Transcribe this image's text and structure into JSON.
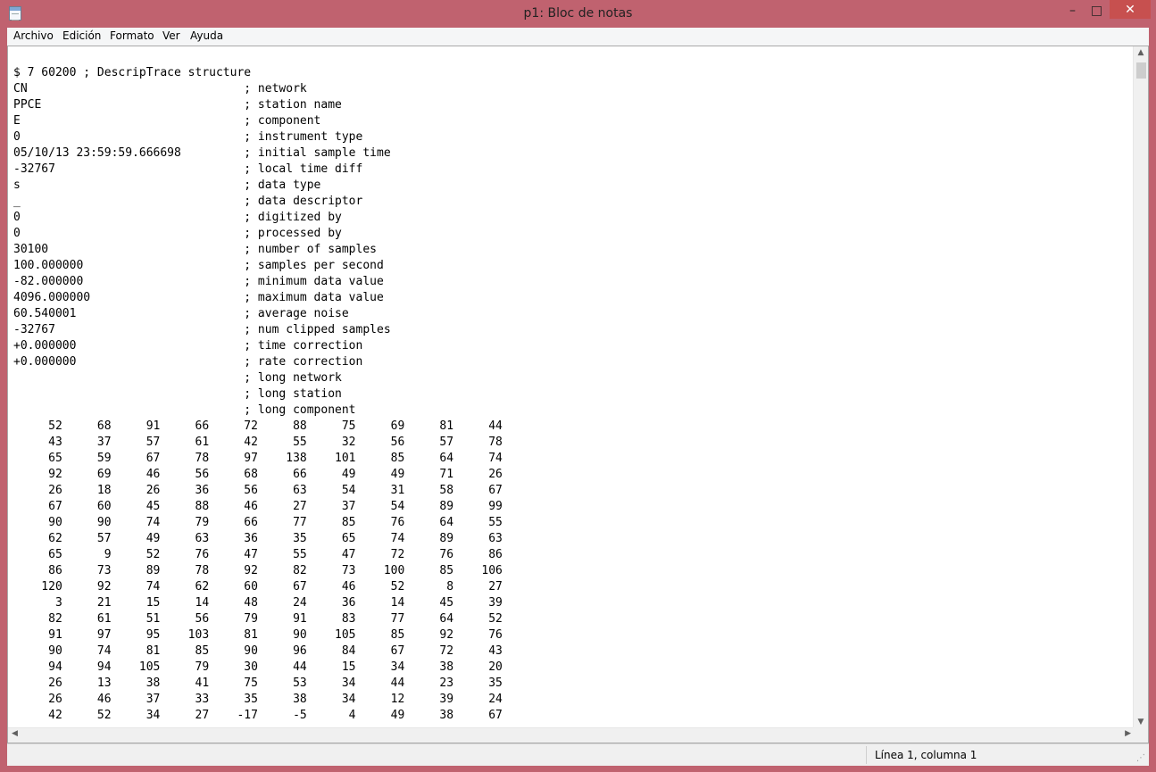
{
  "window": {
    "title": "p1: Bloc de notas"
  },
  "controls": {
    "minimize": "–",
    "maximize": "□",
    "close": "✕"
  },
  "menu": [
    "Archivo",
    "Edición",
    "Formato",
    "Ver",
    "Ayuda"
  ],
  "document": {
    "lines": [
      "$ 7 60200 ; DescripTrace structure",
      "CN                               ; network",
      "PPCE                             ; station name",
      "E                                ; component",
      "0                                ; instrument type",
      "05/10/13 23:59:59.666698         ; initial sample time",
      "-32767                           ; local time diff",
      "s                                ; data type",
      "_                                ; data descriptor",
      "0                                ; digitized by",
      "0                                ; processed by",
      "30100                            ; number of samples",
      "100.000000                       ; samples per second",
      "-82.000000                       ; minimum data value",
      "4096.000000                      ; maximum data value",
      "60.540001                        ; average noise",
      "-32767                           ; num clipped samples",
      "+0.000000                        ; time correction",
      "+0.000000                        ; rate correction",
      "                                 ; long network",
      "                                 ; long station",
      "                                 ; long component"
    ],
    "samples": [
      [
        52,
        68,
        91,
        66,
        72,
        88,
        75,
        69,
        81,
        44
      ],
      [
        43,
        37,
        57,
        61,
        42,
        55,
        32,
        56,
        57,
        78
      ],
      [
        65,
        59,
        67,
        78,
        97,
        138,
        101,
        85,
        64,
        74
      ],
      [
        92,
        69,
        46,
        56,
        68,
        66,
        49,
        49,
        71,
        26
      ],
      [
        26,
        18,
        26,
        36,
        56,
        63,
        54,
        31,
        58,
        67
      ],
      [
        67,
        60,
        45,
        88,
        46,
        27,
        37,
        54,
        89,
        99
      ],
      [
        90,
        90,
        74,
        79,
        66,
        77,
        85,
        76,
        64,
        55
      ],
      [
        62,
        57,
        49,
        63,
        36,
        35,
        65,
        74,
        89,
        63
      ],
      [
        65,
        9,
        52,
        76,
        47,
        55,
        47,
        72,
        76,
        86
      ],
      [
        86,
        73,
        89,
        78,
        92,
        82,
        73,
        100,
        85,
        106
      ],
      [
        120,
        92,
        74,
        62,
        60,
        67,
        46,
        52,
        8,
        27
      ],
      [
        3,
        21,
        15,
        14,
        48,
        24,
        36,
        14,
        45,
        39
      ],
      [
        82,
        61,
        51,
        56,
        79,
        91,
        83,
        77,
        64,
        52
      ],
      [
        91,
        97,
        95,
        103,
        81,
        90,
        105,
        85,
        92,
        76
      ],
      [
        90,
        74,
        81,
        85,
        90,
        96,
        84,
        67,
        72,
        43
      ],
      [
        94,
        94,
        105,
        79,
        30,
        44,
        15,
        34,
        38,
        20
      ],
      [
        26,
        13,
        38,
        41,
        75,
        53,
        34,
        44,
        23,
        35
      ],
      [
        26,
        46,
        37,
        33,
        35,
        38,
        34,
        12,
        39,
        24
      ],
      [
        42,
        52,
        34,
        27,
        -17,
        -5,
        4,
        49,
        38,
        67
      ]
    ]
  },
  "status": {
    "position": "Línea 1, columna 1"
  }
}
